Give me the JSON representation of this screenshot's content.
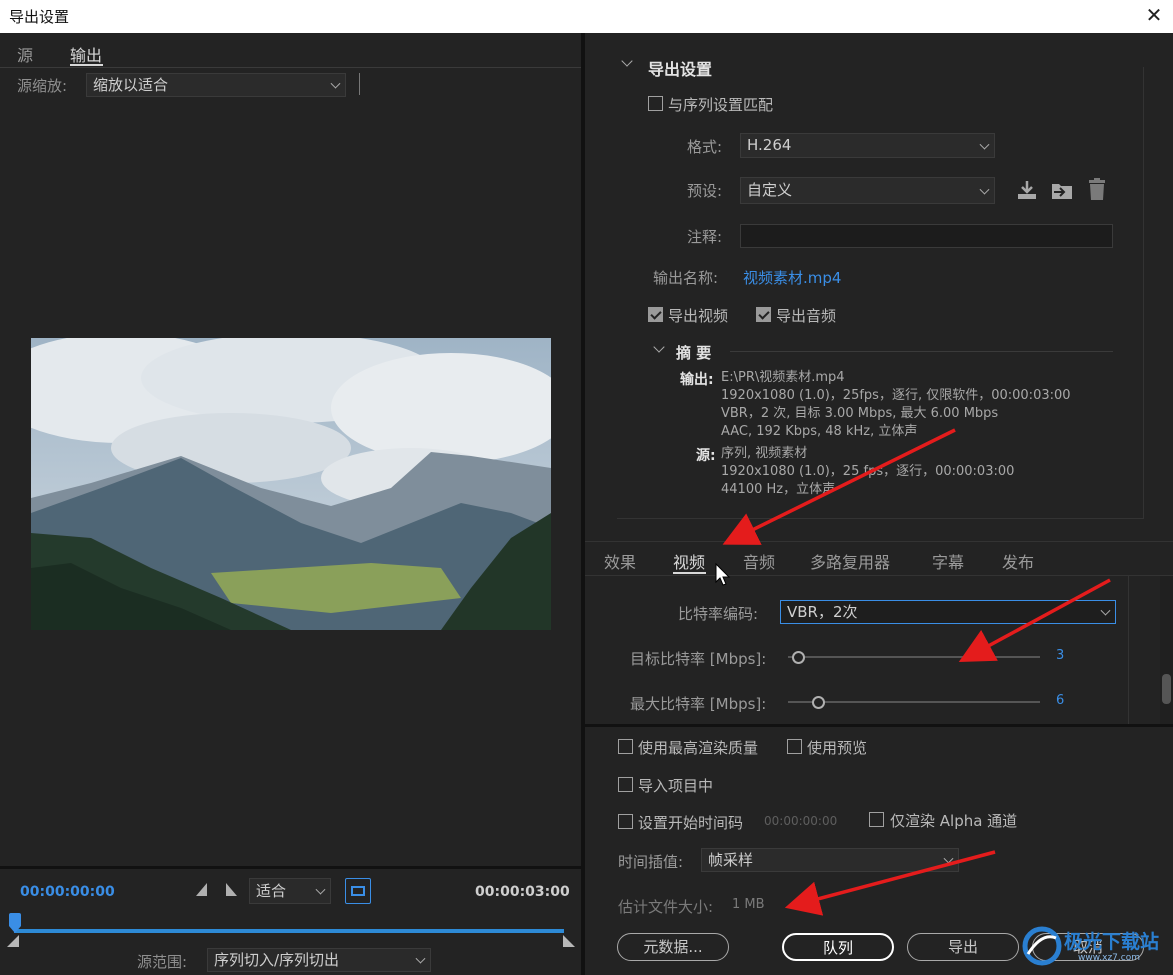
{
  "window": {
    "title": "导出设置",
    "close_glyph": "✕"
  },
  "left": {
    "tabs": [
      {
        "label": "源"
      },
      {
        "label": "输出"
      }
    ],
    "source_scale_label": "源缩放:",
    "source_scale_value": "缩放以适合",
    "timecode_start": "00:00:00:00",
    "timecode_end": "00:00:03:00",
    "fit_value": "适合",
    "source_range_label": "源范围:",
    "source_range_value": "序列切入/序列切出"
  },
  "export_settings": {
    "header": "导出设置",
    "match_sequence_label": "与序列设置匹配",
    "match_sequence_checked": false,
    "format_label": "格式:",
    "format_value": "H.264",
    "preset_label": "预设:",
    "preset_value": "自定义",
    "comment_label": "注释:",
    "comment_value": "",
    "output_name_label": "输出名称:",
    "output_name_value": "视频素材.mp4",
    "export_video_label": "导出视频",
    "export_video_checked": true,
    "export_audio_label": "导出音频",
    "export_audio_checked": true
  },
  "summary": {
    "header": "摘 要",
    "output_label": "输出:",
    "output_lines": [
      "E:\\PR\\视频素材.mp4",
      "1920x1080 (1.0)，25fps，逐行, 仅限软件，00:00:03:00",
      "VBR，2 次, 目标 3.00 Mbps, 最大 6.00 Mbps",
      "AAC, 192 Kbps, 48  kHz, 立体声"
    ],
    "source_label": "源:",
    "source_lines": [
      "序列, 视频素材",
      "1920x1080 (1.0)，25 fps，逐行，00:00:03:00",
      "44100 Hz，立体声"
    ]
  },
  "tabs": [
    {
      "label": "效果"
    },
    {
      "label": "视频"
    },
    {
      "label": "音频"
    },
    {
      "label": "多路复用器"
    },
    {
      "label": "字幕"
    },
    {
      "label": "发布"
    }
  ],
  "video": {
    "bitrate_encoding_label": "比特率编码:",
    "bitrate_encoding_value": "VBR，2次",
    "target_bitrate_label": "目标比特率 [Mbps]:",
    "target_bitrate_value": "3",
    "target_bitrate_fraction": 0.04,
    "max_bitrate_label": "最大比特率 [Mbps]:",
    "max_bitrate_value": "6",
    "max_bitrate_fraction": 0.12
  },
  "options": {
    "max_render_quality_label": "使用最高渲染质量",
    "use_previews_label": "使用预览",
    "import_into_project_label": "导入项目中",
    "set_start_timecode_label": "设置开始时间码",
    "start_timecode_value": "00:00:00:00",
    "render_alpha_only_label": "仅渲染 Alpha 通道",
    "time_interpolation_label": "时间插值:",
    "time_interpolation_value": "帧采样",
    "estimated_size_label": "估计文件大小:",
    "estimated_size_value": "1 MB"
  },
  "buttons": {
    "metadata": "元数据...",
    "queue": "队列",
    "export": "导出",
    "cancel": "取消"
  },
  "watermark": {
    "text": "极光下载站",
    "sub": "www.xz7.com"
  },
  "colors": {
    "accent": "#3a8ee6",
    "annotation": "#e41c1c",
    "panel": "#232323"
  }
}
